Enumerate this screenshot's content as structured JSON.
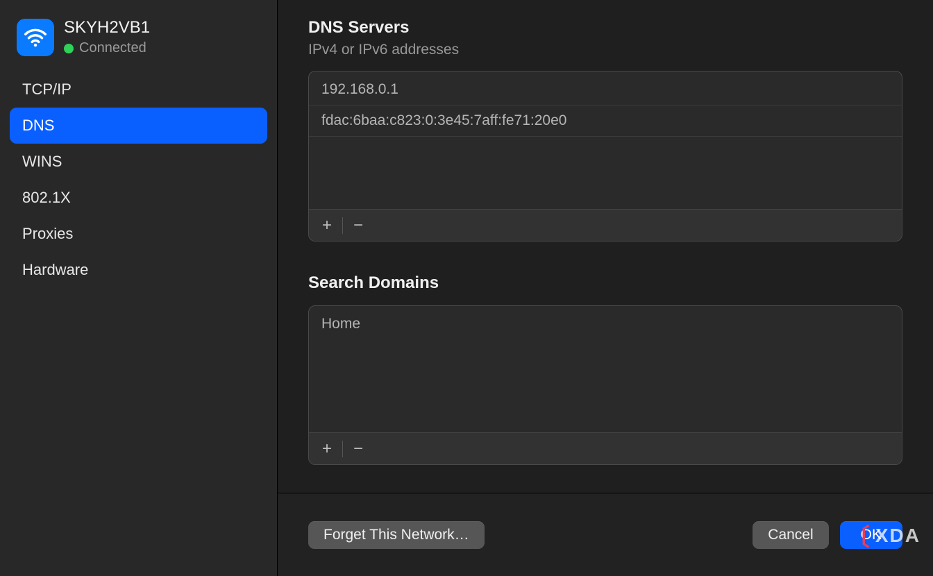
{
  "network": {
    "name": "SKYH2VB1",
    "status": "Connected"
  },
  "sidebar": {
    "items": [
      {
        "label": "TCP/IP",
        "selected": false
      },
      {
        "label": "DNS",
        "selected": true
      },
      {
        "label": "WINS",
        "selected": false
      },
      {
        "label": "802.1X",
        "selected": false
      },
      {
        "label": "Proxies",
        "selected": false
      },
      {
        "label": "Hardware",
        "selected": false
      }
    ]
  },
  "dns": {
    "title": "DNS Servers",
    "subtitle": "IPv4 or IPv6 addresses",
    "servers": [
      "192.168.0.1",
      "fdac:6baa:c823:0:3e45:7aff:fe71:20e0"
    ],
    "add": "+",
    "remove": "−"
  },
  "search": {
    "title": "Search Domains",
    "domains": [
      "Home"
    ],
    "add": "+",
    "remove": "−"
  },
  "footer": {
    "forget": "Forget This Network…",
    "cancel": "Cancel",
    "ok": "OK"
  },
  "watermark": "XDA"
}
